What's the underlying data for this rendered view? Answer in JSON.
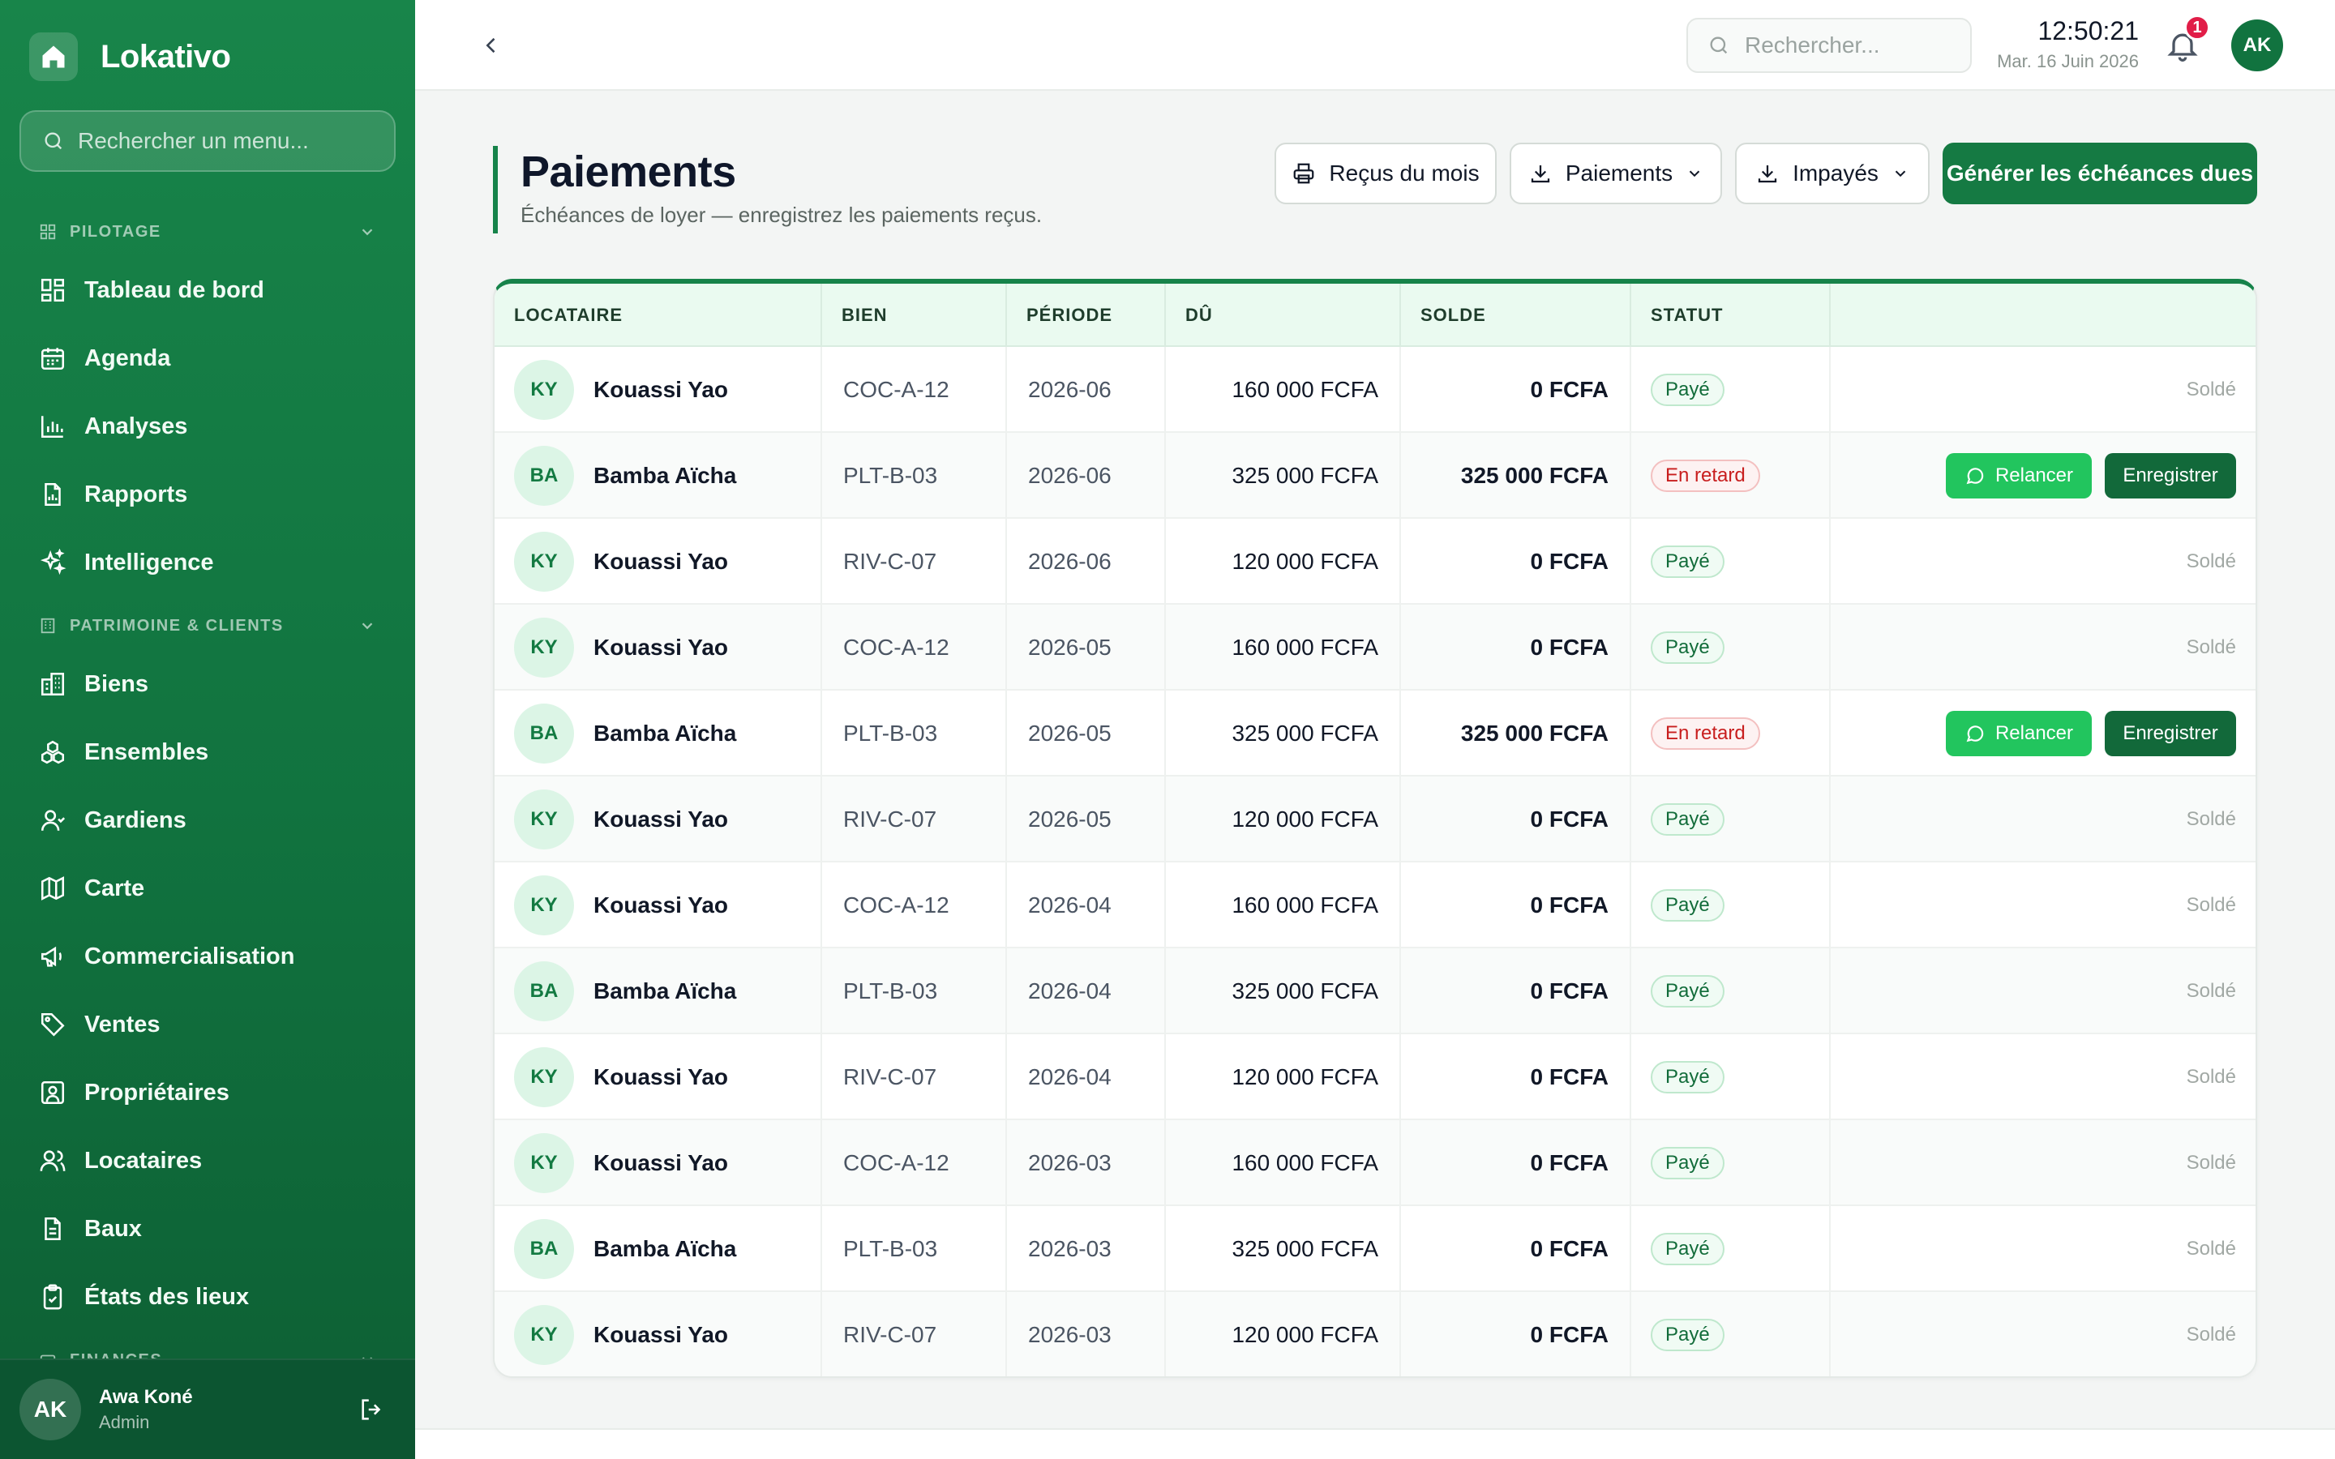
{
  "app": {
    "name": "Lokativo"
  },
  "sidebar": {
    "search_placeholder": "Rechercher un menu...",
    "section_pilotage": "PILOTAGE",
    "section_patrimoine": "PATRIMOINE & CLIENTS",
    "section_finances": "FINANCES",
    "items": [
      {
        "label": "Tableau de bord",
        "icon": "dashboard-icon"
      },
      {
        "label": "Agenda",
        "icon": "calendar-icon"
      },
      {
        "label": "Analyses",
        "icon": "bar-chart-icon"
      },
      {
        "label": "Rapports",
        "icon": "report-icon"
      },
      {
        "label": "Intelligence",
        "icon": "sparkles-icon"
      },
      {
        "label": "Biens",
        "icon": "building-icon"
      },
      {
        "label": "Ensembles",
        "icon": "boxes-icon"
      },
      {
        "label": "Gardiens",
        "icon": "user-icon"
      },
      {
        "label": "Carte",
        "icon": "map-icon"
      },
      {
        "label": "Commercialisation",
        "icon": "megaphone-icon"
      },
      {
        "label": "Ventes",
        "icon": "tag-icon"
      },
      {
        "label": "Propriétaires",
        "icon": "owner-icon"
      },
      {
        "label": "Locataires",
        "icon": "users-icon"
      },
      {
        "label": "Baux",
        "icon": "document-icon"
      },
      {
        "label": "États des lieux",
        "icon": "clipboard-icon"
      }
    ],
    "user": {
      "initials": "AK",
      "name": "Awa Koné",
      "role": "Admin"
    }
  },
  "topbar": {
    "search_placeholder": "Rechercher...",
    "time": "12:50:21",
    "date": "Mar. 16 Juin 2026",
    "notification_count": "1",
    "avatar_initials": "AK"
  },
  "page": {
    "title": "Paiements",
    "subtitle": "Échéances de loyer — enregistrez les paiements reçus.",
    "btn_recus": "Reçus du mois",
    "btn_paiements": "Paiements",
    "btn_impayes": "Impayés",
    "btn_generer": "Générer les échéances dues"
  },
  "table": {
    "headers": [
      "LOCATAIRE",
      "BIEN",
      "PÉRIODE",
      "DÛ",
      "SOLDE",
      "STATUT"
    ],
    "relancer_label": "Relancer",
    "enregistrer_label": "Enregistrer",
    "rows": [
      {
        "initials": "KY",
        "name": "Kouassi Yao",
        "bien": "COC-A-12",
        "periode": "2026-06",
        "du": "160 000 FCFA",
        "solde": "0 FCFA",
        "statut": "Payé",
        "late": false,
        "action": "Soldé"
      },
      {
        "initials": "BA",
        "name": "Bamba Aïcha",
        "bien": "PLT-B-03",
        "periode": "2026-06",
        "du": "325 000 FCFA",
        "solde": "325 000 FCFA",
        "statut": "En retard",
        "late": true,
        "action": ""
      },
      {
        "initials": "KY",
        "name": "Kouassi Yao",
        "bien": "RIV-C-07",
        "periode": "2026-06",
        "du": "120 000 FCFA",
        "solde": "0 FCFA",
        "statut": "Payé",
        "late": false,
        "action": "Soldé"
      },
      {
        "initials": "KY",
        "name": "Kouassi Yao",
        "bien": "COC-A-12",
        "periode": "2026-05",
        "du": "160 000 FCFA",
        "solde": "0 FCFA",
        "statut": "Payé",
        "late": false,
        "action": "Soldé"
      },
      {
        "initials": "BA",
        "name": "Bamba Aïcha",
        "bien": "PLT-B-03",
        "periode": "2026-05",
        "du": "325 000 FCFA",
        "solde": "325 000 FCFA",
        "statut": "En retard",
        "late": true,
        "action": ""
      },
      {
        "initials": "KY",
        "name": "Kouassi Yao",
        "bien": "RIV-C-07",
        "periode": "2026-05",
        "du": "120 000 FCFA",
        "solde": "0 FCFA",
        "statut": "Payé",
        "late": false,
        "action": "Soldé"
      },
      {
        "initials": "KY",
        "name": "Kouassi Yao",
        "bien": "COC-A-12",
        "periode": "2026-04",
        "du": "160 000 FCFA",
        "solde": "0 FCFA",
        "statut": "Payé",
        "late": false,
        "action": "Soldé"
      },
      {
        "initials": "BA",
        "name": "Bamba Aïcha",
        "bien": "PLT-B-03",
        "periode": "2026-04",
        "du": "325 000 FCFA",
        "solde": "0 FCFA",
        "statut": "Payé",
        "late": false,
        "action": "Soldé"
      },
      {
        "initials": "KY",
        "name": "Kouassi Yao",
        "bien": "RIV-C-07",
        "periode": "2026-04",
        "du": "120 000 FCFA",
        "solde": "0 FCFA",
        "statut": "Payé",
        "late": false,
        "action": "Soldé"
      },
      {
        "initials": "KY",
        "name": "Kouassi Yao",
        "bien": "COC-A-12",
        "periode": "2026-03",
        "du": "160 000 FCFA",
        "solde": "0 FCFA",
        "statut": "Payé",
        "late": false,
        "action": "Soldé"
      },
      {
        "initials": "BA",
        "name": "Bamba Aïcha",
        "bien": "PLT-B-03",
        "periode": "2026-03",
        "du": "325 000 FCFA",
        "solde": "0 FCFA",
        "statut": "Payé",
        "late": false,
        "action": "Soldé"
      },
      {
        "initials": "KY",
        "name": "Kouassi Yao",
        "bien": "RIV-C-07",
        "periode": "2026-03",
        "du": "120 000 FCFA",
        "solde": "0 FCFA",
        "statut": "Payé",
        "late": false,
        "action": "Soldé"
      }
    ]
  },
  "colors": {
    "brand": "#16834a",
    "brand_dark": "#12693a",
    "accent": "#22c55e",
    "danger": "#c81e1e"
  }
}
